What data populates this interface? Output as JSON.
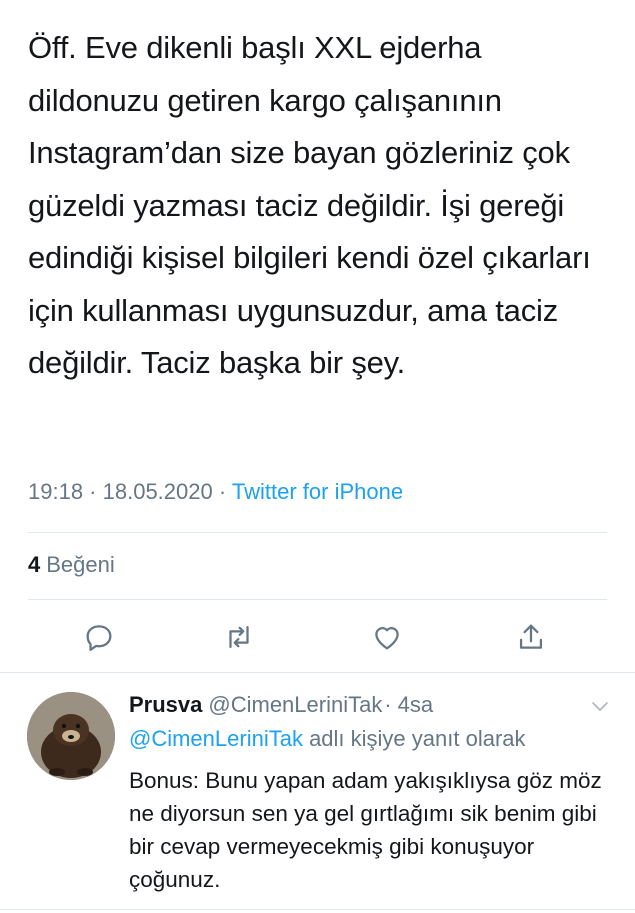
{
  "tweet": {
    "text": "Öff. Eve dikenli başlı XXL ejderha dildonuzu getiren kargo çalışanının Instagram’dan size bayan gözleriniz çok güzeldi yazması taciz değildir. İşi gereği edindiği kişisel bilgileri kendi özel çıkarları için kullanması uygunsuzdur, ama taciz değildir. Taciz başka bir şey.",
    "time": "19:18",
    "date": "18.05.2020",
    "separator": " · ",
    "source": "Twitter for iPhone"
  },
  "stats": {
    "likes_count": "4",
    "likes_label": "Beğeni"
  },
  "actions": [
    {
      "icon": "reply-icon"
    },
    {
      "icon": "retweet-icon"
    },
    {
      "icon": "like-icon"
    },
    {
      "icon": "share-icon"
    }
  ],
  "reply": {
    "name": "Prusva",
    "handle": "@CimenLeriniTak",
    "time": "· 4sa",
    "context_mention": "@CimenLeriniTak",
    "context_text": " adlı kişiye yanıt olarak",
    "text": "Bonus: Bunu yapan adam yakışıklıysa göz möz ne diyorsun sen ya gel gırtlağımı sik benim gibi bir cevap vermeyecekmiş gibi konuşuyor çoğunuz.",
    "avatar_icon": "wolverine-avatar"
  },
  "colors": {
    "text": "#14171a",
    "secondary": "#657786",
    "accent": "#1da1f2",
    "divider": "#e1e8ed"
  }
}
